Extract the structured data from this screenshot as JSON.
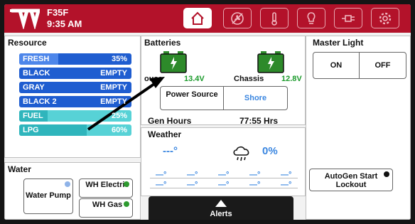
{
  "header": {
    "model": "F35F",
    "time": "9:35 AM",
    "tabs": [
      "home-icon",
      "fan-off-icon",
      "thermometer-icon",
      "lightbulb-icon",
      "plug-icon",
      "gear-icon"
    ]
  },
  "resource": {
    "title": "Resource",
    "tanks": [
      {
        "label": "FRESH",
        "value": "35%",
        "color": "blue",
        "fill": 0.35
      },
      {
        "label": "BLACK",
        "value": "EMPTY",
        "color": "blue",
        "fill": 0
      },
      {
        "label": "GRAY",
        "value": "EMPTY",
        "color": "blue",
        "fill": 0
      },
      {
        "label": "BLACK 2",
        "value": "EMPTY",
        "color": "blue",
        "fill": 0
      },
      {
        "label": "FUEL",
        "value": "25%",
        "color": "teal",
        "fill": 0.25
      },
      {
        "label": "LPG",
        "value": "60%",
        "color": "teal",
        "fill": 0.6
      }
    ]
  },
  "water": {
    "title": "Water",
    "pump_label": "Water Pump",
    "wh_electric_label": "WH Electric",
    "wh_gas_label": "WH Gas"
  },
  "batteries": {
    "title": "Batteries",
    "house_label": "ouse",
    "house_voltage": "13.4V",
    "chassis_label": "Chassis",
    "chassis_voltage": "12.8V",
    "power_source_label": "Power Source",
    "shore_label": "Shore",
    "gen_hours_label": "Gen Hours",
    "gen_hours_value": "77:55 Hrs"
  },
  "weather": {
    "title": "Weather",
    "temp": "---°",
    "humidity": "0%",
    "cells": [
      "—°",
      "—°",
      "—°",
      "—°",
      "—°",
      "—°",
      "—°",
      "—°",
      "—°",
      "—°"
    ]
  },
  "master_light": {
    "title": "Master Light",
    "on_label": "ON",
    "off_label": "OFF"
  },
  "autogen": {
    "label": "AutoGen Start Lockout"
  },
  "alerts": {
    "label": "Alerts"
  },
  "colors": {
    "header": "#b3122a",
    "tank_blue": "#1f5dd0",
    "tank_teal": "#57d2d6",
    "battery_green": "#2d8a2a",
    "value_green": "#1a9a2a",
    "accent_blue": "#3a86e0"
  }
}
